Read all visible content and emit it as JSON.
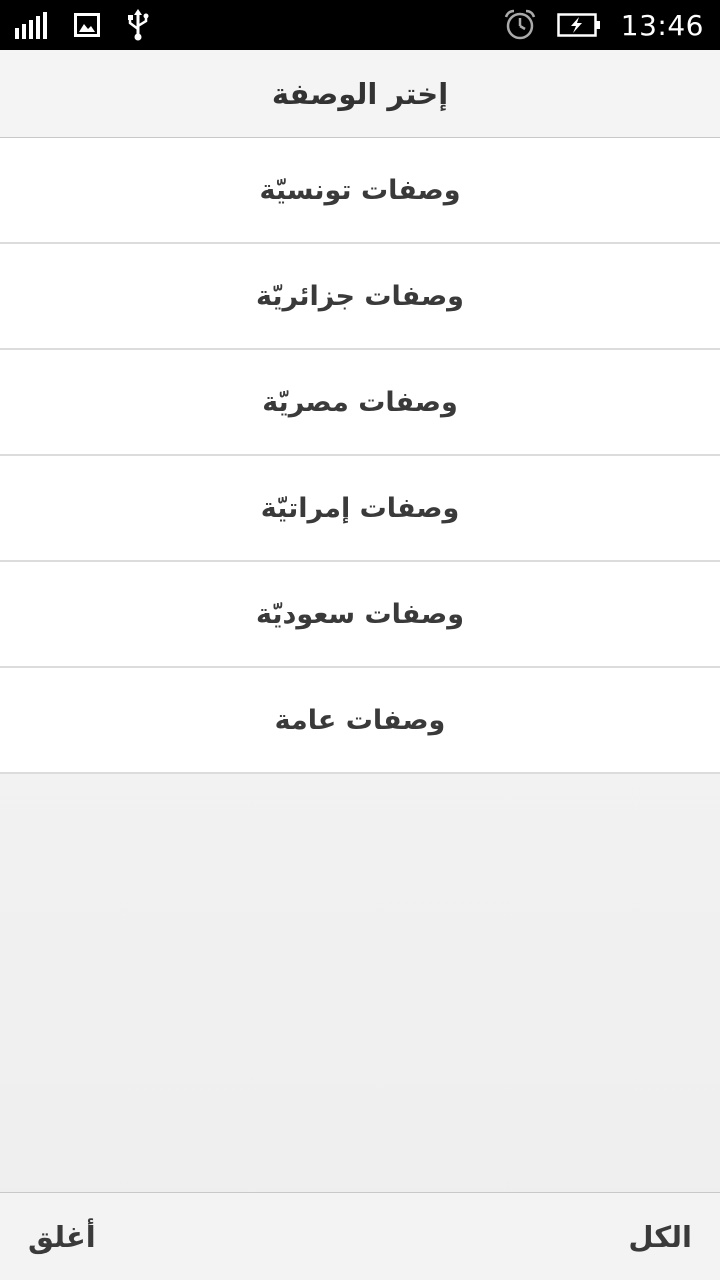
{
  "status_bar": {
    "time": "13:46",
    "icons": [
      "signal-icon",
      "image-icon",
      "usb-icon",
      "alarm-icon",
      "battery-charging-icon"
    ]
  },
  "header": {
    "title": "إختر الوصفة"
  },
  "list": {
    "items": [
      {
        "label": "وصفات تونسيّة"
      },
      {
        "label": "وصفات جزائريّة"
      },
      {
        "label": "وصفات مصريّة"
      },
      {
        "label": "وصفات إمراتيّة"
      },
      {
        "label": "وصفات سعوديّة"
      },
      {
        "label": "وصفات عامة"
      }
    ]
  },
  "footer": {
    "close_label": "أغلق",
    "all_label": "الكل"
  },
  "colors": {
    "status_bar_bg": "#000000",
    "text": "#3a3a3a",
    "divider": "#dcdcdc"
  }
}
